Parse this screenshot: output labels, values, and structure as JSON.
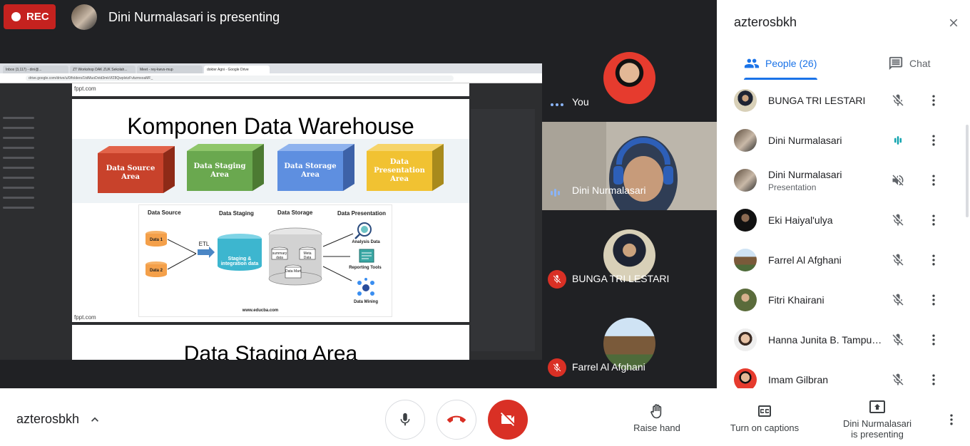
{
  "top": {
    "rec_label": "REC",
    "presenting_text": "Dini Nurmalasari is presenting"
  },
  "presentation": {
    "browser_tabs": [
      "Inbox (3,117) - dini@...",
      "ZT Workshop DAK ZUK Sekolah...",
      "Meet - rey-kwvs-mup",
      "dokter Agni - Google Drive"
    ],
    "url": "drive.google.com/drive/u/0/folders/1tdMuoDxtd3mkVfZ8QwplxtzFvbzmxoaMF_",
    "footer_text": "fppt.com",
    "slide_title": "Komponen Data Warehouse",
    "boxes": [
      "Data Source Area",
      "Data Staging Area",
      "Data Storage Area",
      "Data Presentation Area"
    ],
    "diagram": {
      "headers": [
        "Data Source",
        "Data Staging",
        "Data Storage",
        "Data Presentation"
      ],
      "data1": "Data 1",
      "data2": "Data 2",
      "etl": "ETL",
      "staging": "Staging & integration data",
      "summary": "summary data",
      "meta": "Meta Data",
      "mart": "Data Mart",
      "analysis": "Analysis Data",
      "reporting": "Reporting Tools",
      "mining": "Data Mining",
      "source_url": "www.educba.com"
    },
    "next_slide_title": "Data Staging Area"
  },
  "tiles": [
    {
      "name": "You"
    },
    {
      "name": "Dini Nurmalasari"
    },
    {
      "name": "BUNGA TRI LESTARI"
    },
    {
      "name": "Farrel Al Afghani"
    }
  ],
  "panel": {
    "title": "azterosbkh",
    "people_tab": "People (26)",
    "chat_tab": "Chat",
    "people": [
      {
        "name": "BUNGA TRI LESTARI",
        "sub": "",
        "mic": "muted"
      },
      {
        "name": "Dini Nurmalasari",
        "sub": "",
        "mic": "speaking"
      },
      {
        "name": "Dini Nurmalasari",
        "sub": "Presentation",
        "mic": "volume-off"
      },
      {
        "name": "Eki Haiyal'ulya",
        "sub": "",
        "mic": "muted"
      },
      {
        "name": "Farrel Al Afghani",
        "sub": "",
        "mic": "muted"
      },
      {
        "name": "Fitri Khairani",
        "sub": "",
        "mic": "muted"
      },
      {
        "name": "Hanna Junita B. Tampubolon",
        "sub": "",
        "mic": "muted"
      },
      {
        "name": "Imam Gilbran",
        "sub": "",
        "mic": "muted"
      }
    ]
  },
  "bottom": {
    "meeting_code": "azterosbkh",
    "raise_hand": "Raise hand",
    "captions": "Turn on captions",
    "presenting_line1": "Dini Nurmalasari",
    "presenting_line2": "is presenting"
  },
  "colors": {
    "rec_red": "#c5221f",
    "accent_blue": "#1a73e8",
    "speaking_teal": "#12a4af",
    "hangup_red": "#d93025"
  }
}
